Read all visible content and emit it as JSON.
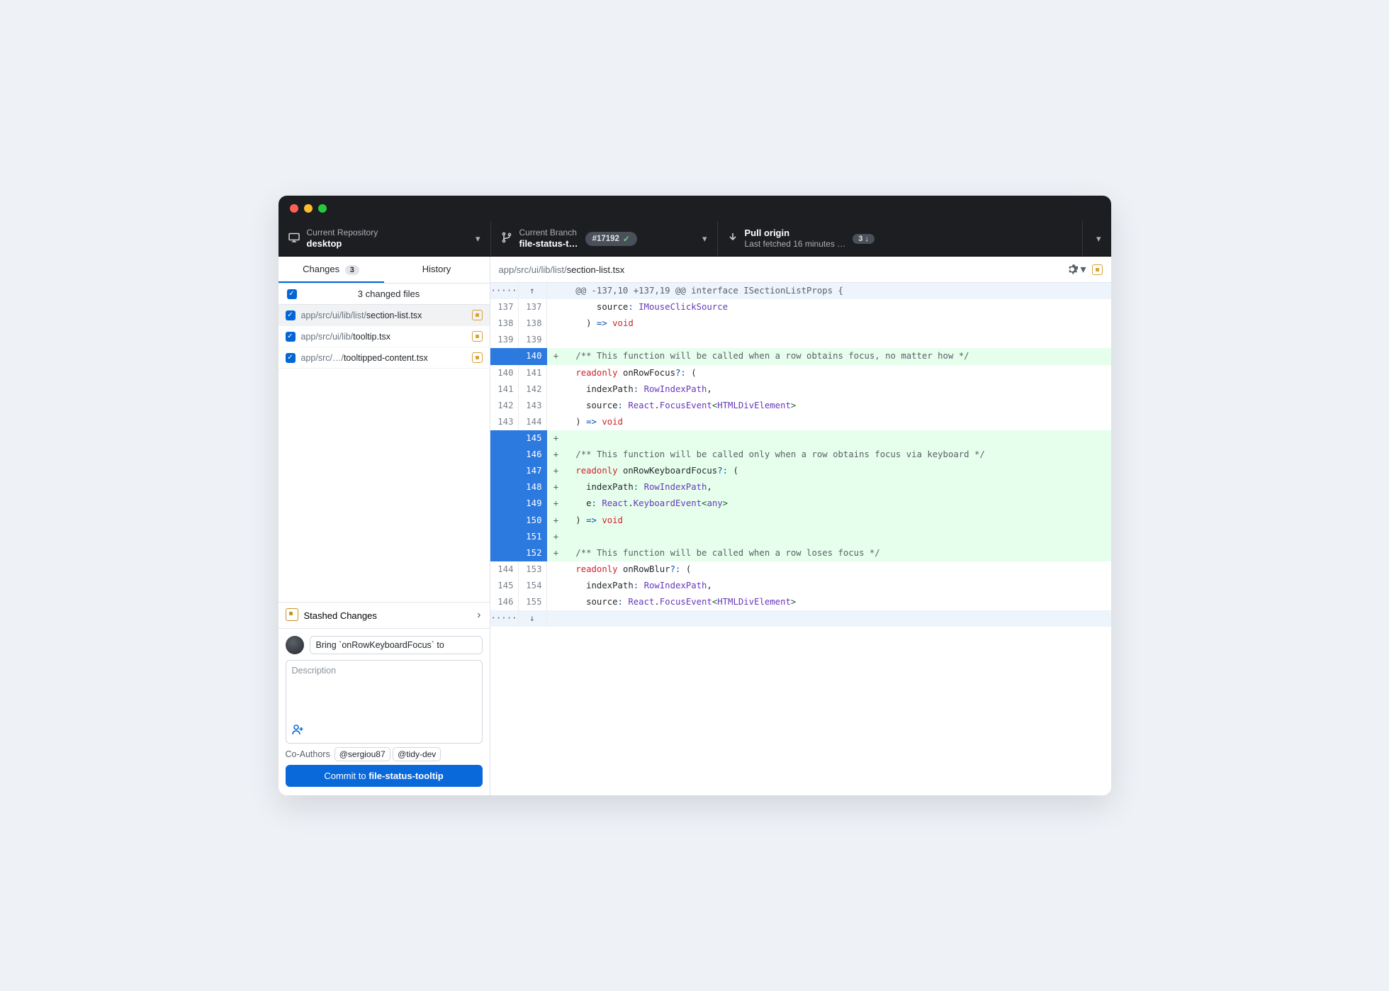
{
  "toolbar": {
    "repo": {
      "label": "Current Repository",
      "value": "desktop"
    },
    "branch": {
      "label": "Current Branch",
      "value": "file-status-t…",
      "pr": "#17192"
    },
    "pull": {
      "label": "Pull origin",
      "sub": "Last fetched 16 minutes …",
      "count": "3"
    }
  },
  "tabs": {
    "changes": "Changes",
    "changes_count": "3",
    "history": "History"
  },
  "files": {
    "header": "3 changed files",
    "items": [
      {
        "dir": "app/src/ui/lib/list/",
        "name": "section-list.tsx"
      },
      {
        "dir": "app/src/ui/lib/",
        "name": "tooltip.tsx"
      },
      {
        "dir": "app/src/…/",
        "name": "tooltipped-content.tsx"
      }
    ]
  },
  "stash": "Stashed Changes",
  "commit": {
    "summary": "Bring `onRowKeyboardFocus` to",
    "desc_placeholder": "Description",
    "coauthors_label": "Co-Authors",
    "coauthors": [
      "@sergiou87",
      "@tidy-dev"
    ],
    "button_prefix": "Commit to ",
    "button_branch": "file-status-tooltip"
  },
  "filepath": {
    "dir": "app/src/ui/lib/list/",
    "name": "section-list.tsx"
  },
  "diff": {
    "hunk": "@@ -137,10 +137,19 @@ interface ISectionListProps {",
    "lines": [
      {
        "o": "137",
        "n": "137",
        "t": "ctx",
        "seg": [
          [
            "pn",
            "      source"
          ],
          [
            "op",
            ": "
          ],
          [
            "ty",
            "IMouseClickSource"
          ]
        ]
      },
      {
        "o": "138",
        "n": "138",
        "t": "ctx",
        "seg": [
          [
            "pn",
            "    ) "
          ],
          [
            "op",
            "=> "
          ],
          [
            "kw",
            "void"
          ]
        ]
      },
      {
        "o": "139",
        "n": "139",
        "t": "ctx",
        "seg": [
          [
            "pn",
            ""
          ]
        ]
      },
      {
        "o": "",
        "n": "140",
        "t": "add",
        "seg": [
          [
            "cm",
            "  /** This function will be called when a row obtains focus, no matter how */"
          ]
        ]
      },
      {
        "o": "140",
        "n": "141",
        "t": "ctx",
        "seg": [
          [
            "pn",
            "  "
          ],
          [
            "kw",
            "readonly"
          ],
          [
            "pn",
            " onRowFocus"
          ],
          [
            "op",
            "?: "
          ],
          [
            "pn",
            "("
          ]
        ]
      },
      {
        "o": "141",
        "n": "142",
        "t": "ctx",
        "seg": [
          [
            "pn",
            "    indexPath"
          ],
          [
            "op",
            ": "
          ],
          [
            "ty",
            "RowIndexPath"
          ],
          [
            "pn",
            ","
          ]
        ]
      },
      {
        "o": "142",
        "n": "143",
        "t": "ctx",
        "seg": [
          [
            "pn",
            "    source"
          ],
          [
            "op",
            ": "
          ],
          [
            "ty",
            "React"
          ],
          [
            "pn",
            "."
          ],
          [
            "ty",
            "FocusEvent"
          ],
          [
            "ta",
            "<"
          ],
          [
            "ty",
            "HTMLDivElement"
          ],
          [
            "ta",
            ">"
          ]
        ]
      },
      {
        "o": "143",
        "n": "144",
        "t": "ctx",
        "seg": [
          [
            "pn",
            "  ) "
          ],
          [
            "op",
            "=> "
          ],
          [
            "kw",
            "void"
          ]
        ]
      },
      {
        "o": "",
        "n": "145",
        "t": "add",
        "seg": [
          [
            "pn",
            ""
          ]
        ]
      },
      {
        "o": "",
        "n": "146",
        "t": "add",
        "seg": [
          [
            "cm",
            "  /** This function will be called only when a row obtains focus via keyboard */"
          ]
        ]
      },
      {
        "o": "",
        "n": "147",
        "t": "add",
        "seg": [
          [
            "pn",
            "  "
          ],
          [
            "kw",
            "readonly"
          ],
          [
            "pn",
            " onRowKeyboardFocus"
          ],
          [
            "op",
            "?: "
          ],
          [
            "pn",
            "("
          ]
        ]
      },
      {
        "o": "",
        "n": "148",
        "t": "add",
        "seg": [
          [
            "pn",
            "    indexPath"
          ],
          [
            "op",
            ": "
          ],
          [
            "ty",
            "RowIndexPath"
          ],
          [
            "pn",
            ","
          ]
        ]
      },
      {
        "o": "",
        "n": "149",
        "t": "add",
        "seg": [
          [
            "pn",
            "    e"
          ],
          [
            "op",
            ": "
          ],
          [
            "ty",
            "React"
          ],
          [
            "pn",
            "."
          ],
          [
            "ty",
            "KeyboardEvent"
          ],
          [
            "ta",
            "<"
          ],
          [
            "ty",
            "any"
          ],
          [
            "ta",
            ">"
          ]
        ]
      },
      {
        "o": "",
        "n": "150",
        "t": "add",
        "seg": [
          [
            "pn",
            "  ) "
          ],
          [
            "op",
            "=> "
          ],
          [
            "kw",
            "void"
          ]
        ]
      },
      {
        "o": "",
        "n": "151",
        "t": "add",
        "seg": [
          [
            "pn",
            ""
          ]
        ]
      },
      {
        "o": "",
        "n": "152",
        "t": "add",
        "seg": [
          [
            "cm",
            "  /** This function will be called when a row loses focus */"
          ]
        ]
      },
      {
        "o": "144",
        "n": "153",
        "t": "ctx",
        "seg": [
          [
            "pn",
            "  "
          ],
          [
            "kw",
            "readonly"
          ],
          [
            "pn",
            " onRowBlur"
          ],
          [
            "op",
            "?: "
          ],
          [
            "pn",
            "("
          ]
        ]
      },
      {
        "o": "145",
        "n": "154",
        "t": "ctx",
        "seg": [
          [
            "pn",
            "    indexPath"
          ],
          [
            "op",
            ": "
          ],
          [
            "ty",
            "RowIndexPath"
          ],
          [
            "pn",
            ","
          ]
        ]
      },
      {
        "o": "146",
        "n": "155",
        "t": "ctx",
        "seg": [
          [
            "pn",
            "    source"
          ],
          [
            "op",
            ": "
          ],
          [
            "ty",
            "React"
          ],
          [
            "pn",
            "."
          ],
          [
            "ty",
            "FocusEvent"
          ],
          [
            "ta",
            "<"
          ],
          [
            "ty",
            "HTMLDivElement"
          ],
          [
            "ta",
            ">"
          ]
        ]
      }
    ]
  }
}
